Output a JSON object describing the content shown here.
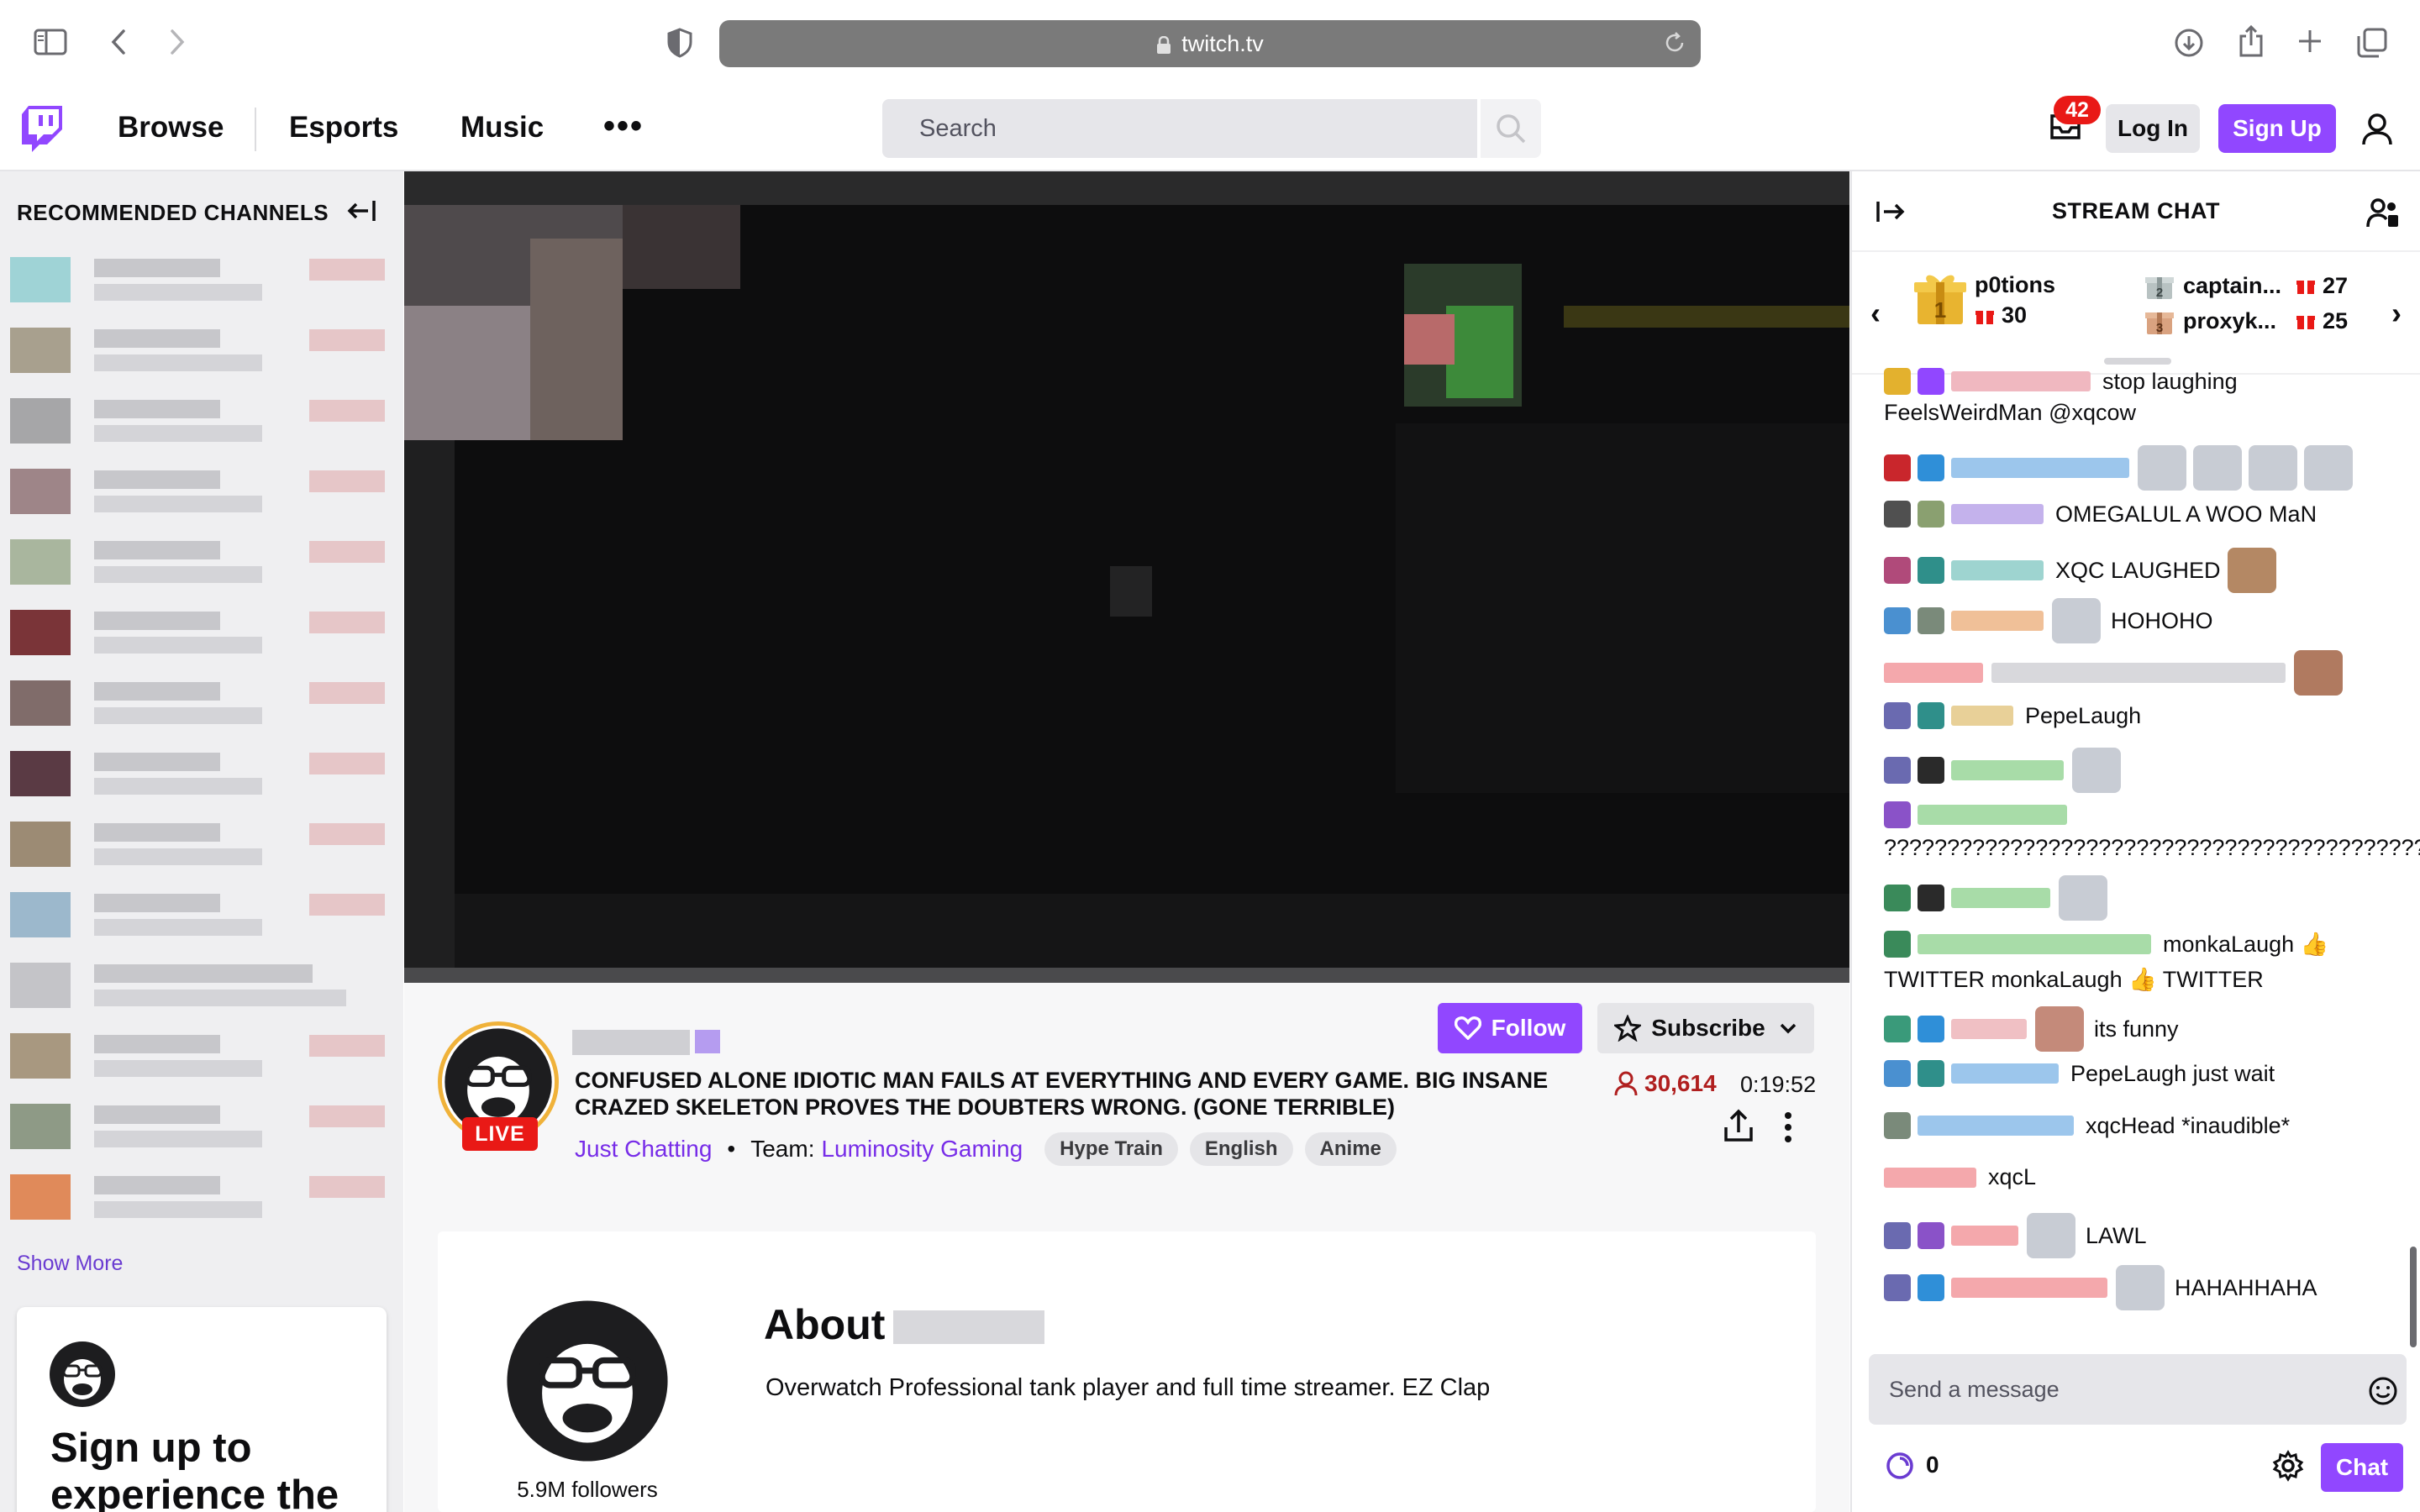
{
  "browser": {
    "url": "twitch.tv"
  },
  "nav": {
    "browse": "Browse",
    "esports": "Esports",
    "music": "Music",
    "more": "•••",
    "search_placeholder": "Search",
    "inbox_count": "42",
    "login": "Log In",
    "signup": "Sign Up"
  },
  "sidebar": {
    "title": "RECOMMENDED CHANNELS",
    "show_more": "Show More",
    "signup_card_text": "Sign up to experience the"
  },
  "stream": {
    "live_label": "LIVE",
    "title": "CONFUSED ALONE IDIOTIC MAN FAILS AT EVERYTHING AND EVERY GAME. BIG INSANE CRAZED SKELETON PROVES THE DOUBTERS WRONG. (GONE TERRIBLE)",
    "category": "Just Chatting",
    "team_label": "Team:",
    "team": "Luminosity Gaming",
    "tags": [
      "Hype Train",
      "English",
      "Anime"
    ],
    "follow": "Follow",
    "subscribe": "Subscribe",
    "viewers": "30,614",
    "uptime": "0:19:52"
  },
  "about": {
    "title": "About",
    "description": "Overwatch Professional tank player and full time streamer. EZ Clap",
    "followers": "5.9M followers"
  },
  "chat": {
    "title": "STREAM CHAT",
    "leaderboard": {
      "first_name": "p0tions",
      "first_count": "30",
      "second_name": "captain...",
      "second_count": "27",
      "third_name": "proxyk...",
      "third_count": "25"
    },
    "messages": [
      "stop laughing",
      "FeelsWeirdMan @xqcow",
      "OMEGALUL A WOO MaN",
      "XQC LAUGHED",
      "HOHOHO",
      "PepeLaugh",
      "???????????????????????????????????????????",
      "monkaLaugh 👍",
      "TWITTER monkaLaugh 👍 TWITTER",
      "its funny",
      "PepeLaugh just wait",
      "xqcHead *inaudible*",
      "xqcL",
      "LAWL",
      "HAHAHHAHA"
    ],
    "input_placeholder": "Send a message",
    "points": "0",
    "chat_button": "Chat"
  },
  "colors": {
    "brand": "#9147ff",
    "live": "#e91916",
    "link": "#772ce8"
  }
}
